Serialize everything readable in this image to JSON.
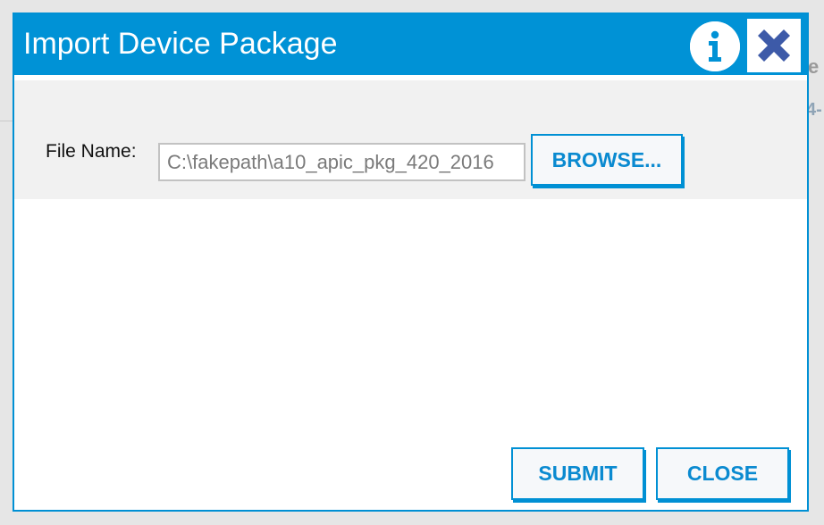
{
  "background": {
    "text_1": "e",
    "text_2": "4-"
  },
  "dialog": {
    "title": "Import Device Package",
    "info_icon": "info-icon",
    "close_icon": "close-icon",
    "file_label": "File Name:",
    "file_value": "C:\\fakepath\\a10_apic_pkg_420_2016",
    "browse_label": "BROWSE...",
    "submit_label": "SUBMIT",
    "close_label": "CLOSE"
  },
  "colors": {
    "accent": "#0092d6",
    "button_text": "#0a8ad0",
    "close_icon": "#3d5aa8",
    "form_band": "#f1f1f1"
  }
}
